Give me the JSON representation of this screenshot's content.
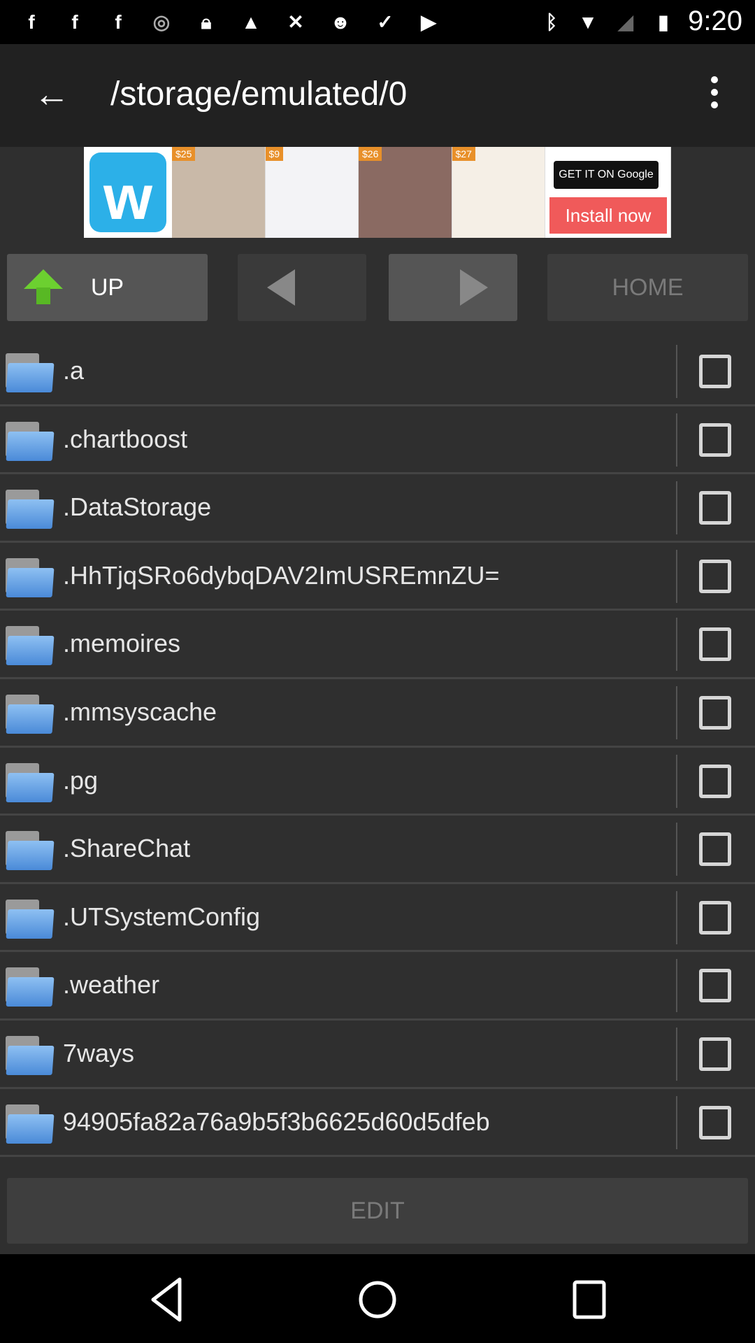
{
  "status_bar": {
    "time": "9:20",
    "icons": [
      "facebook-icon",
      "facebook-icon",
      "facebook-icon",
      "data-saver-icon",
      "lock-icon",
      "warning-icon",
      "fake-gps-icon",
      "android-icon",
      "clipboard-check-icon",
      "play-store-icon",
      "bluetooth-icon",
      "wifi-icon",
      "no-signal-icon",
      "battery-charging-icon"
    ]
  },
  "app_bar": {
    "title": "/storage/emulated/0"
  },
  "ad": {
    "prices": [
      "$25",
      "$9",
      "$26",
      "$27"
    ],
    "google_play": "GET IT ON Google Play",
    "install": "Install now"
  },
  "toolbar": {
    "up": "UP",
    "home": "HOME"
  },
  "files": [
    ".a",
    ".chartboost",
    ".DataStorage",
    ".HhTjqSRo6dybqDAV2ImUSREmnZU=",
    ".memoires",
    ".mmsyscache",
    ".pg",
    ".ShareChat",
    ".UTSystemConfig",
    ".weather",
    "7ways",
    "94905fa82a76a9b5f3b6625d60d5dfeb"
  ],
  "edit_label": "EDIT"
}
